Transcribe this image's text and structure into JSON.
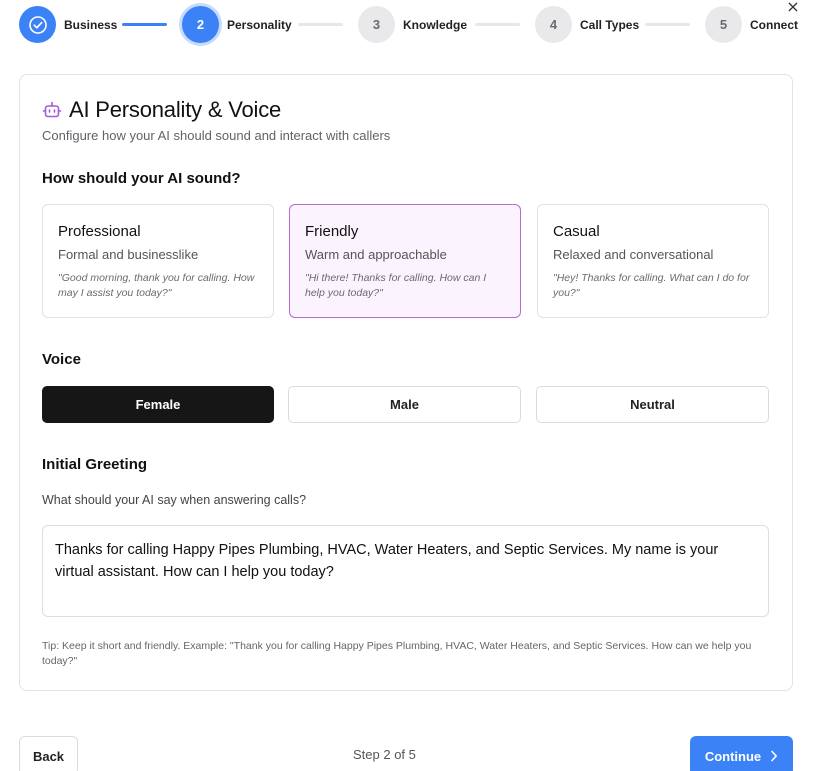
{
  "close_label": "×",
  "stepper": {
    "steps": [
      {
        "number": "",
        "label": "Business",
        "state": "done"
      },
      {
        "number": "2",
        "label": "Personality",
        "state": "active"
      },
      {
        "number": "3",
        "label": "Knowledge",
        "state": "pending"
      },
      {
        "number": "4",
        "label": "Call Types",
        "state": "pending"
      },
      {
        "number": "5",
        "label": "Connect",
        "state": "pending"
      }
    ]
  },
  "header": {
    "title": "AI Personality & Voice",
    "subtitle": "Configure how your AI should sound and interact with callers"
  },
  "tone": {
    "heading": "How should your AI sound?",
    "options": [
      {
        "name": "Professional",
        "desc": "Formal and businesslike",
        "example": "\"Good morning, thank you for calling. How may I assist you today?\"",
        "selected": false
      },
      {
        "name": "Friendly",
        "desc": "Warm and approachable",
        "example": "\"Hi there! Thanks for calling. How can I help you today?\"",
        "selected": true
      },
      {
        "name": "Casual",
        "desc": "Relaxed and conversational",
        "example": "\"Hey! Thanks for calling. What can I do for you?\"",
        "selected": false
      }
    ]
  },
  "voice": {
    "heading": "Voice",
    "options": [
      {
        "label": "Female",
        "selected": true
      },
      {
        "label": "Male",
        "selected": false
      },
      {
        "label": "Neutral",
        "selected": false
      }
    ]
  },
  "greeting": {
    "heading": "Initial Greeting",
    "question": "What should your AI say when answering calls?",
    "value": "Thanks for calling Happy Pipes Plumbing, HVAC, Water Heaters, and Septic Services. My name is your virtual assistant. How can I help you today?",
    "tip": "Tip: Keep it short and friendly. Example: \"Thank you for calling Happy Pipes Plumbing, HVAC, Water Heaters, and Septic Services. How can we help you today?\""
  },
  "footer": {
    "back_label": "Back",
    "step_counter": "Step 2 of 5",
    "continue_label": "Continue",
    "continue_icon": "chevron-right-icon"
  },
  "colors": {
    "accent": "#3b82f6",
    "selected_tone_bg": "#fbf3fd",
    "selected_tone_border": "#b86ad0",
    "icon_purple": "#a35bd6",
    "selected_voice_bg": "#161616"
  }
}
